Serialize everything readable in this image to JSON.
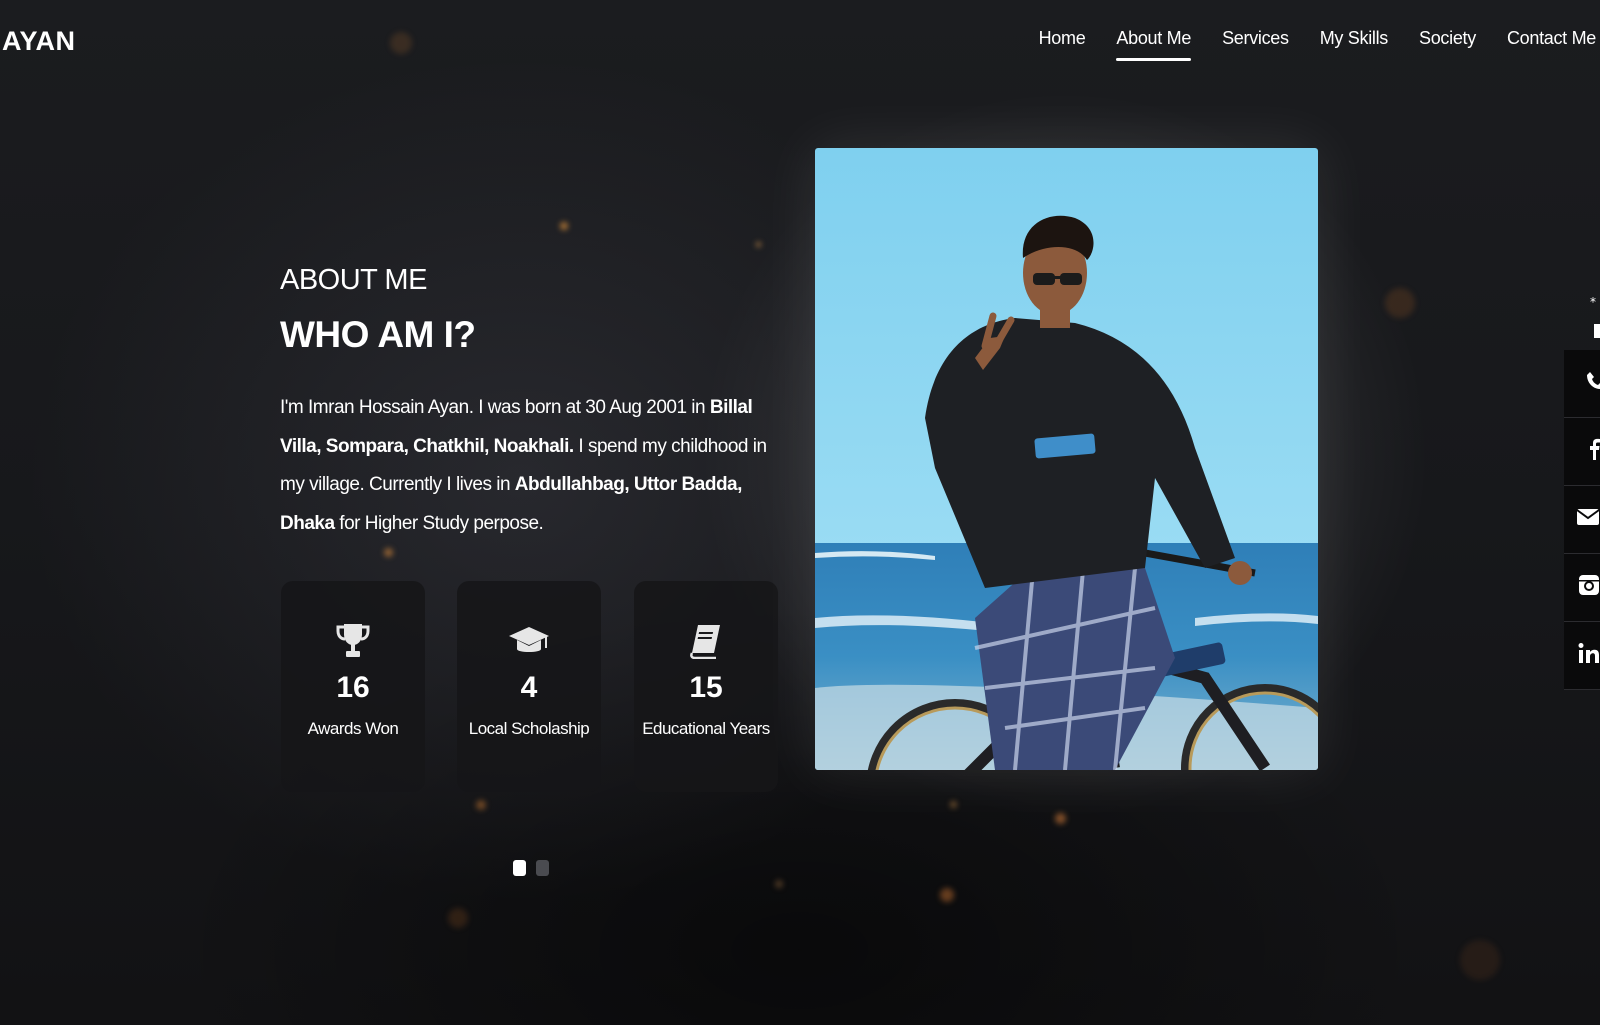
{
  "brand": {
    "name": "AYAN"
  },
  "nav": {
    "items": [
      "Home",
      "About Me",
      "Services",
      "My Skills",
      "Society",
      "Contact Me"
    ],
    "active": "About Me"
  },
  "about": {
    "eyebrow": "ABOUT ME",
    "title": "WHO AM I?",
    "bio": [
      {
        "text": "I'm Imran Hossain Ayan. I was born at 30 Aug 2001 in ",
        "bold": false
      },
      {
        "text": "Billal Villa, Sompara, Chatkhil, Noakhali.",
        "bold": true
      },
      {
        "text": " I spend my childhood in my village. Currently I lives in ",
        "bold": false
      },
      {
        "text": "Abdullahbag, Uttor Badda, Dhaka",
        "bold": true
      },
      {
        "text": " for Higher Study perpose.",
        "bold": false
      }
    ]
  },
  "stats": [
    {
      "icon": "trophy-icon",
      "value": "16",
      "label": "Awards Won"
    },
    {
      "icon": "graduation-cap-icon",
      "value": "4",
      "label": "Local Scholaship"
    },
    {
      "icon": "book-icon",
      "value": "15",
      "label": "Educational Years"
    }
  ],
  "carousel": {
    "slides": 2,
    "active_index": 0
  },
  "photo": {
    "subject": "profile-photo"
  },
  "social": [
    "phone-icon",
    "facebook-icon",
    "email-icon",
    "instagram-icon",
    "linkedin-icon"
  ],
  "colors": {
    "background": "#17181b",
    "text": "#ffffff",
    "card": "#161618",
    "social_bar": "#0a0a0b",
    "dot_inactive": "#4a4b50"
  }
}
